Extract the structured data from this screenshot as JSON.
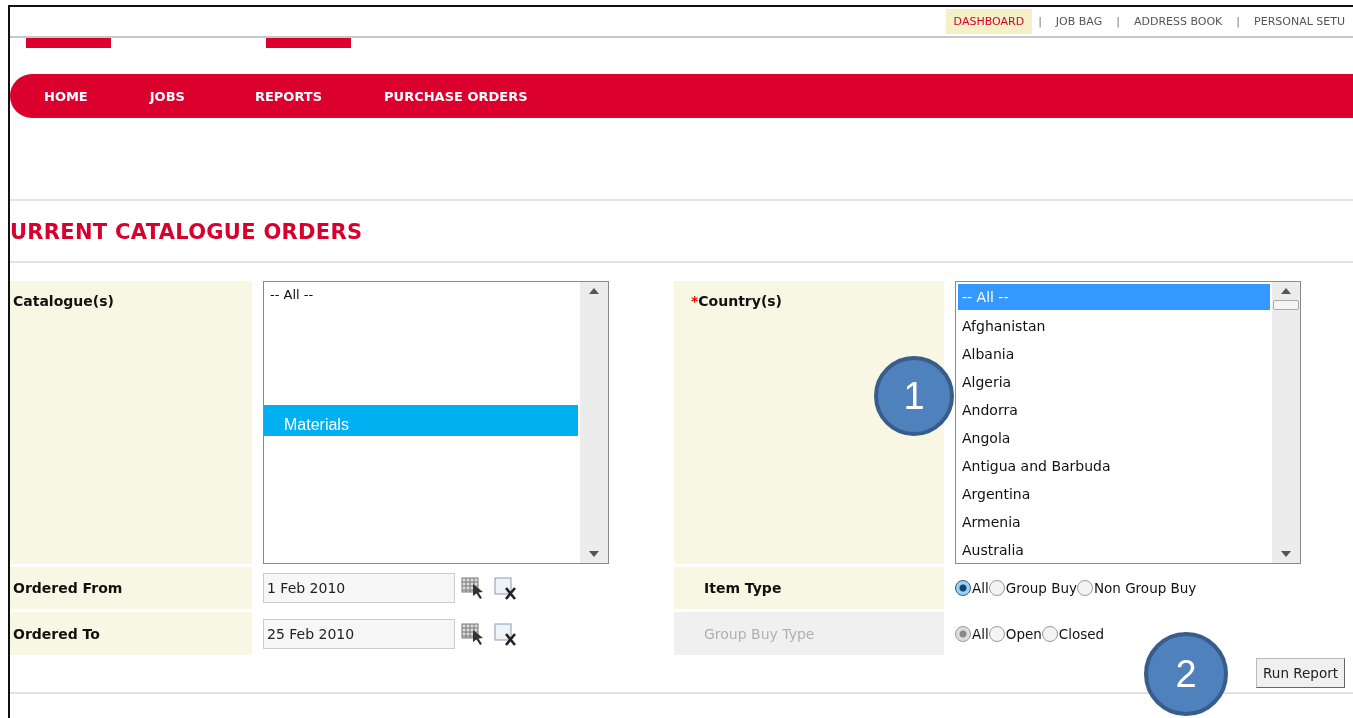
{
  "top_links": [
    {
      "label": "DASHBOARD",
      "selected": true
    },
    {
      "label": "JOB BAG",
      "selected": false
    },
    {
      "label": "ADDRESS BOOK",
      "selected": false
    },
    {
      "label": "PERSONAL SETU",
      "selected": false
    }
  ],
  "top_separator": "|",
  "nav": [
    "HOME",
    "JOBS",
    "REPORTS",
    "PURCHASE ORDERS"
  ],
  "page_title": "URRENT CATALOGUE ORDERS",
  "form": {
    "catalogues": {
      "label": "Catalogue(s)",
      "options": [
        {
          "label": "-- All --",
          "selected": false
        },
        {
          "label": "Materials",
          "selected": true
        }
      ]
    },
    "ordered_from": {
      "label": "Ordered From",
      "value": "1 Feb 2010"
    },
    "ordered_to": {
      "label": "Ordered To",
      "value": "25 Feb 2010"
    },
    "countries": {
      "label": "Country(s)",
      "required_mark": "*",
      "options": [
        {
          "label": "-- All --",
          "selected": true
        },
        {
          "label": "Afghanistan",
          "selected": false
        },
        {
          "label": "Albania",
          "selected": false
        },
        {
          "label": "Algeria",
          "selected": false
        },
        {
          "label": "Andorra",
          "selected": false
        },
        {
          "label": "Angola",
          "selected": false
        },
        {
          "label": "Antigua and Barbuda",
          "selected": false
        },
        {
          "label": "Argentina",
          "selected": false
        },
        {
          "label": "Armenia",
          "selected": false
        },
        {
          "label": "Australia",
          "selected": false
        }
      ]
    },
    "item_type": {
      "label": "Item Type",
      "disabled": false,
      "options": [
        {
          "label": "All",
          "selected": true
        },
        {
          "label": "Group Buy",
          "selected": false
        },
        {
          "label": "Non Group Buy",
          "selected": false
        }
      ]
    },
    "group_buy_type": {
      "label": "Group Buy Type",
      "disabled": true,
      "options": [
        {
          "label": "All",
          "selected": true
        },
        {
          "label": "Open",
          "selected": false
        },
        {
          "label": "Closed",
          "selected": false
        }
      ]
    }
  },
  "run_button": "Run Report",
  "callouts": [
    "1",
    "2"
  ]
}
